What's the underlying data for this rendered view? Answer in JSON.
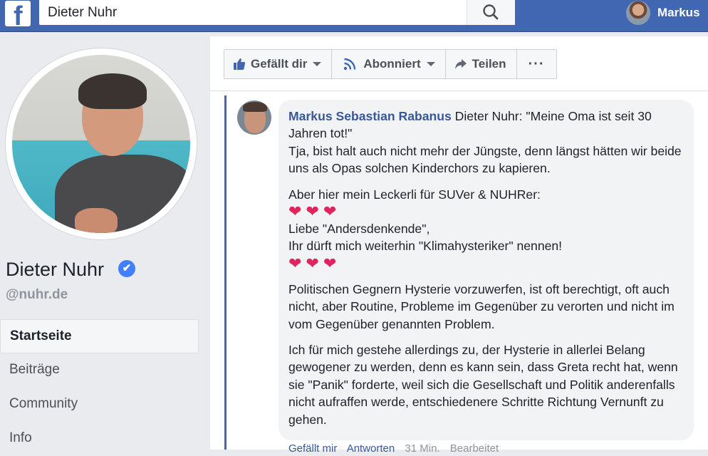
{
  "topbar": {
    "logo_letter": "f",
    "search_value": "Dieter Nuhr",
    "user_name": "Markus"
  },
  "profile": {
    "name": "Dieter Nuhr",
    "handle": "@nuhr.de",
    "verified_mark": "✔"
  },
  "nav": {
    "items": [
      {
        "label": "Startseite",
        "active": true
      },
      {
        "label": "Beiträge"
      },
      {
        "label": "Community"
      },
      {
        "label": "Info"
      }
    ]
  },
  "page_actions": {
    "like_label": "Gefällt dir",
    "follow_label": "Abonniert",
    "share_label": "Teilen",
    "more_label": "···"
  },
  "comment": {
    "author": "Markus Sebastian Rabanus",
    "line1": " Dieter Nuhr: \"Meine Oma ist seit 30 Jahren tot!\"",
    "line2": "Tja, bist halt auch nicht mehr der Jüngste, denn längst hätten wir beide uns als Opas solchen Kinderchors zu kapieren.",
    "para2_a": "Aber hier mein Leckerli für SUVer & NUHRer:",
    "hearts": "❤❤❤",
    "para2_b": "Liebe \"Andersdenkende\",",
    "para2_c": "Ihr dürft mich weiterhin \"Klimahysteriker\" nennen!",
    "para3": "Politischen Gegnern Hysterie vorzuwerfen, ist oft berechtigt, oft auch nicht, aber Routine, Probleme im Gegenüber zu verorten und nicht im vom Gegenüber genannten Problem.",
    "para4": "Ich für mich gestehe allerdings zu, der Hysterie in allerlei Belang gewogener zu werden, denn es kann sein, dass Greta recht hat, wenn sie \"Panik\" forderte, weil sich die Gesellschaft und Politik anderenfalls nicht aufraffen werde, entschiedenere Schritte Richtung Vernunft zu gehen.",
    "action_like": "Gefällt mir",
    "action_reply": "Antworten",
    "time": "31 Min.",
    "action_edit": "Bearbeitet"
  },
  "colors": {
    "brand": "#4267b2",
    "link": "#385898",
    "heart": "#e0245e"
  },
  "icons": {
    "logo": "facebook-logo",
    "search": "search-icon",
    "like": "thumbs-up-icon",
    "follow": "rss-icon",
    "share": "share-arrow-icon",
    "verified": "verified-badge-icon"
  }
}
